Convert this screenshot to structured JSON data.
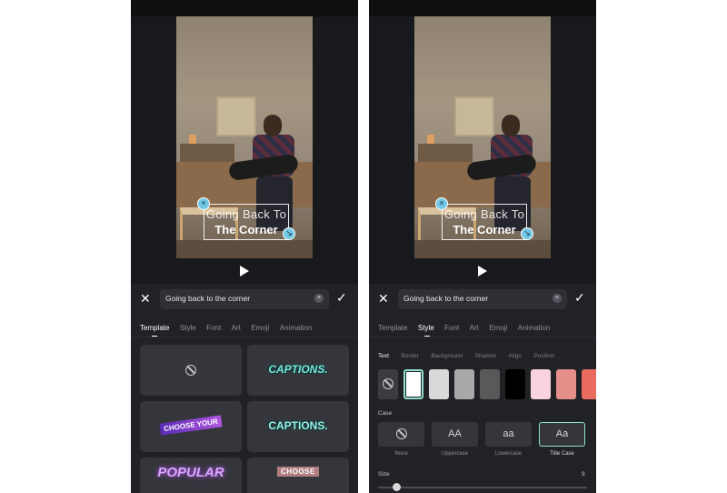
{
  "caption": {
    "line1": "Going Back To",
    "line2": "The Corner"
  },
  "editor": {
    "input_value": "Going back to the corner",
    "clear_icon": "×",
    "close_icon": "✕",
    "confirm_icon": "✓"
  },
  "left_panel": {
    "tabs": [
      "Template",
      "Style",
      "Font",
      "Art",
      "Emoji",
      "Animation"
    ],
    "active_tab": "Template",
    "templates": [
      {
        "name": "none-icon"
      },
      {
        "label": "CAPTIONS."
      },
      {
        "label": "CHOOSE YOUR"
      },
      {
        "label": "CAPTIONS."
      },
      {
        "label": "POPULAR"
      },
      {
        "label": "CHOOSE"
      }
    ]
  },
  "right_panel": {
    "tabs": [
      "Template",
      "Style",
      "Font",
      "Art",
      "Emoji",
      "Animation"
    ],
    "active_tab": "Style",
    "subtabs": [
      "Text",
      "Border",
      "Background",
      "Shadow",
      "Align",
      "Position"
    ],
    "active_subtab": "Text",
    "swatch_colors": [
      "#ffffff",
      "#d9d9d9",
      "#a9a9a9",
      "#595959",
      "#000000",
      "#f8d3df",
      "#e48f89",
      "#ea6a5d"
    ],
    "selected_swatch": "#ffffff",
    "case_label": "Case",
    "case_options": [
      {
        "glyph": "",
        "label": "None"
      },
      {
        "glyph": "AA",
        "label": "Uppercase"
      },
      {
        "glyph": "aa",
        "label": "Lowercase"
      },
      {
        "glyph": "Aa",
        "label": "Title Case"
      }
    ],
    "selected_case": "Title Case",
    "size_label": "Size",
    "size_value": "9"
  },
  "colors": {
    "accent": "#8fe0cf",
    "handle": "#72c8e6"
  }
}
